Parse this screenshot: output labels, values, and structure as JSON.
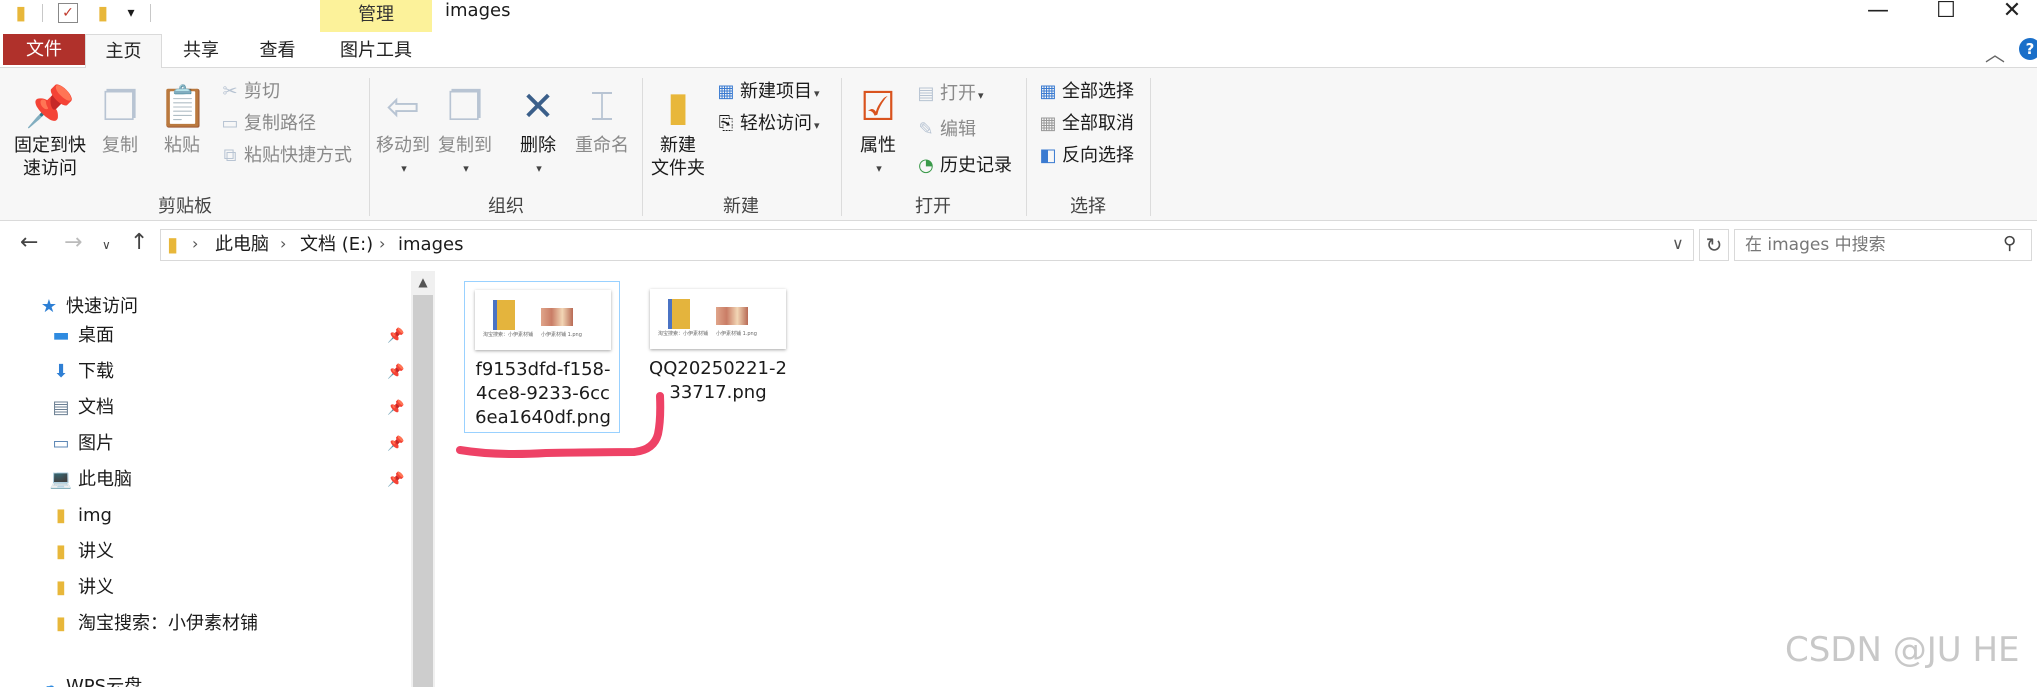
{
  "window": {
    "title": "images",
    "context_tab_group": "管理",
    "controls": {
      "minimize": "—",
      "maximize": "☐",
      "close": "✕"
    }
  },
  "quick_access_toolbar": {
    "dropdown": "▾"
  },
  "ribbon": {
    "tabs": {
      "file": "文件",
      "home": "主页",
      "share": "共享",
      "view": "查看",
      "picture_tools": "图片工具"
    },
    "clipboard": {
      "group_label": "剪贴板",
      "pin_line1": "固定到快",
      "pin_line2": "速访问",
      "copy": "复制",
      "paste": "粘贴",
      "cut": "剪切",
      "copy_path": "复制路径",
      "paste_shortcut": "粘贴快捷方式"
    },
    "organize": {
      "group_label": "组织",
      "move_to": "移动到",
      "copy_to": "复制到",
      "delete": "删除",
      "rename": "重命名"
    },
    "new": {
      "group_label": "新建",
      "new_folder_line1": "新建",
      "new_folder_line2": "文件夹",
      "new_item": "新建项目",
      "easy_access": "轻松访问"
    },
    "open": {
      "group_label": "打开",
      "properties": "属性",
      "open": "打开",
      "edit": "编辑",
      "history": "历史记录"
    },
    "select": {
      "group_label": "选择",
      "select_all": "全部选择",
      "select_none": "全部取消",
      "invert_selection": "反向选择"
    }
  },
  "address_bar": {
    "breadcrumb": [
      "此电脑",
      "文档 (E:)",
      "images"
    ],
    "search_placeholder": "在 images 中搜索"
  },
  "nav_pane": {
    "quick_access": "快速访问",
    "items": [
      {
        "label": "桌面",
        "icon": "desktop-icon",
        "pinned": true
      },
      {
        "label": "下载",
        "icon": "download-icon",
        "pinned": true
      },
      {
        "label": "文档",
        "icon": "document-icon",
        "pinned": true
      },
      {
        "label": "图片",
        "icon": "pictures-icon",
        "pinned": true
      },
      {
        "label": "此电脑",
        "icon": "computer-icon",
        "pinned": true
      },
      {
        "label": "img",
        "icon": "folder-icon",
        "pinned": false
      },
      {
        "label": "讲义",
        "icon": "folder-icon",
        "pinned": false
      },
      {
        "label": "讲义",
        "icon": "folder-icon",
        "pinned": false
      },
      {
        "label": "淘宝搜索：小伊素材铺",
        "icon": "folder-icon",
        "pinned": false
      },
      {
        "label": "WPS云盘",
        "icon": "cloud-icon",
        "pinned": false
      }
    ]
  },
  "files": [
    {
      "name": "f9153dfd-f158-4ce8-9233-6cc6ea1640df.png",
      "name_lines": [
        "f9153dfd-f158-",
        "4ce8-9233-6cc",
        "6ea1640df.png"
      ],
      "selected": true,
      "thumb_caption_left": "淘宝搜索：小伊素材铺",
      "thumb_caption_right": "小伊素材铺 1.png"
    },
    {
      "name": "QQ20250221-233717.png",
      "name_lines": [
        "QQ20250221-2",
        "33717.png"
      ],
      "selected": false,
      "thumb_caption_left": "淘宝搜索：小伊素材铺",
      "thumb_caption_right": "小伊素材铺 1.png"
    }
  ],
  "watermark": "CSDN @JU HE",
  "colors": {
    "file_tab": "#b0312b",
    "manage_tab": "#fcf29a",
    "selection_border": "#99d1ff",
    "annotation": "#ee4266",
    "accent_blue": "#1a6fc9"
  }
}
